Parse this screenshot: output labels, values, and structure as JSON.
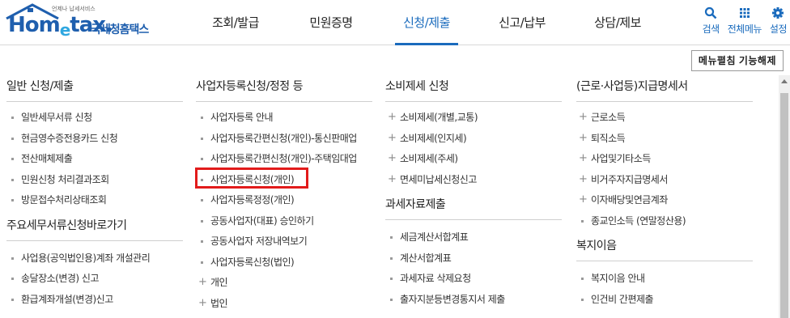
{
  "logo": {
    "word_pre": "Hom",
    "word_e": "e",
    "word_post": "tax.",
    "tagline": "언제나 납세서비스",
    "korean": "국세청홈택스"
  },
  "gnb": [
    {
      "label": "조회/발급",
      "active": false
    },
    {
      "label": "민원증명",
      "active": false
    },
    {
      "label": "신청/제출",
      "active": true
    },
    {
      "label": "신고/납부",
      "active": false
    },
    {
      "label": "상담/제보",
      "active": false
    }
  ],
  "util": {
    "search": "검색",
    "all_menu": "전체메뉴",
    "settings": "설정"
  },
  "toggle_button": "메뉴펼침 기능해제",
  "columns": {
    "general": {
      "title": "일반 신청/제출",
      "items": [
        "일반세무서류 신청",
        "현금영수증전용카드 신청",
        "전산매체제출",
        "민원신청 처리결과조회",
        "방문접수처리상태조회"
      ],
      "sub_title": "주요세무서류신청바로가기",
      "sub_items": [
        "사업용(공익법인용)계좌 개설관리",
        "송달장소(변경) 신고",
        "환급계좌개설(변경)신고"
      ]
    },
    "business": {
      "title": "사업자등록신청/정정 등",
      "items": [
        "사업자등록 안내",
        "사업자등록간편신청(개인)-통신판매업",
        "사업자등록간편신청(개인)-주택임대업",
        "사업자등록신청(개인)",
        "사업자등록정정(개인)",
        "공동사업자(대표) 승인하기",
        "공동사업자 저장내역보기",
        "사업자등록신청(법인)",
        "개인",
        "법인"
      ]
    },
    "consumption": {
      "title": "소비제세 신청",
      "items": [
        "소비제세(개별,교통)",
        "소비제세(인지세)",
        "소비제세(주세)",
        "면세미납세신청신고"
      ],
      "sub_title": "과세자료제출",
      "sub_items": [
        "세금계산서합계표",
        "계산서합계표",
        "과세자료 삭제요청",
        "출자지분등변경통지서 제출"
      ]
    },
    "payment": {
      "title": "(근로·사업등)지급명세서",
      "items": [
        "근로소득",
        "퇴직소득",
        "사업및기타소득",
        "비거주자지급명세서",
        "이자배당및연금계좌",
        "종교인소득 (연말정산용)"
      ],
      "sub_title": "복지이음",
      "sub_items": [
        "복지이음 안내",
        "인건비 간편제출"
      ]
    }
  }
}
